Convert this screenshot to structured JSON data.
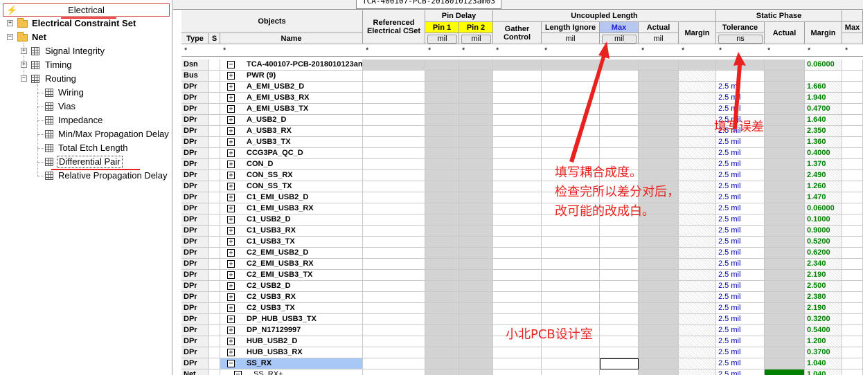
{
  "tree": {
    "root": "Electrical",
    "constraint_set": "Electrical Constraint Set",
    "net": "Net",
    "net_children": [
      "Signal Integrity",
      "Timing",
      "Routing"
    ],
    "routing_children": [
      "Wiring",
      "Vias",
      "Impedance",
      "Min/Max Propagation Delay",
      "Total Etch Length",
      "Differential Pair",
      "Relative Propagation Delay"
    ],
    "selected": "Differential Pair"
  },
  "sheet_tab": "TCA-400107-PCB-2018010123am03",
  "columns": {
    "objects": "Objects",
    "type": "Type",
    "s": "S",
    "name": "Name",
    "referenced": "Referenced Electrical CSet",
    "pin_delay": "Pin Delay",
    "pin1": "Pin 1",
    "pin2": "Pin 2",
    "uncoupled": "Uncoupled Length",
    "gather": "Gather Control",
    "length_ignore": "Length Ignore",
    "max": "Max",
    "actual": "Actual",
    "margin": "Margin",
    "static_phase": "Static Phase",
    "tolerance": "Tolerance",
    "sp_actual": "Actual",
    "sp_margin": "Margin",
    "max2": "Max",
    "unit_mil": "mil",
    "unit_ns": "ns",
    "filter": "*"
  },
  "rows": [
    {
      "type": "Dsn",
      "expander": "minus",
      "name": "TCA-400107-PCB-2018010123am",
      "tol": "",
      "margin": "0.06000"
    },
    {
      "type": "Bus",
      "expander": "plus",
      "name": "PWR (9)",
      "tol": "",
      "margin": ""
    },
    {
      "type": "DPr",
      "expander": "plus",
      "name": "A_EMI_USB2_D",
      "tol": "2.5 mil",
      "margin": "1.660"
    },
    {
      "type": "DPr",
      "expander": "plus",
      "name": "A_EMI_USB3_RX",
      "tol": "2.5 mil",
      "margin": "1.940"
    },
    {
      "type": "DPr",
      "expander": "plus",
      "name": "A_EMI_USB3_TX",
      "tol": "2.5 mil",
      "margin": "0.4700"
    },
    {
      "type": "DPr",
      "expander": "plus",
      "name": "A_USB2_D",
      "tol": "2.5 mil",
      "margin": "1.640"
    },
    {
      "type": "DPr",
      "expander": "plus",
      "name": "A_USB3_RX",
      "tol": "2.5 mil",
      "margin": "2.350"
    },
    {
      "type": "DPr",
      "expander": "plus",
      "name": "A_USB3_TX",
      "tol": "2.5 mil",
      "margin": "1.360"
    },
    {
      "type": "DPr",
      "expander": "plus",
      "name": "CCG3PA_QC_D",
      "tol": "2.5 mil",
      "margin": "0.4000"
    },
    {
      "type": "DPr",
      "expander": "plus",
      "name": "CON_D",
      "tol": "2.5 mil",
      "margin": "1.370"
    },
    {
      "type": "DPr",
      "expander": "plus",
      "name": "CON_SS_RX",
      "tol": "2.5 mil",
      "margin": "2.490"
    },
    {
      "type": "DPr",
      "expander": "plus",
      "name": "CON_SS_TX",
      "tol": "2.5 mil",
      "margin": "1.260"
    },
    {
      "type": "DPr",
      "expander": "plus",
      "name": "C1_EMI_USB2_D",
      "tol": "2.5 mil",
      "margin": "1.470"
    },
    {
      "type": "DPr",
      "expander": "plus",
      "name": "C1_EMI_USB3_RX",
      "tol": "2.5 mil",
      "margin": "0.06000"
    },
    {
      "type": "DPr",
      "expander": "plus",
      "name": "C1_USB2_D",
      "tol": "2.5 mil",
      "margin": "0.1000"
    },
    {
      "type": "DPr",
      "expander": "plus",
      "name": "C1_USB3_RX",
      "tol": "2.5 mil",
      "margin": "0.9000"
    },
    {
      "type": "DPr",
      "expander": "plus",
      "name": "C1_USB3_TX",
      "tol": "2.5 mil",
      "margin": "0.5200"
    },
    {
      "type": "DPr",
      "expander": "plus",
      "name": "C2_EMI_USB2_D",
      "tol": "2.5 mil",
      "margin": "0.6200"
    },
    {
      "type": "DPr",
      "expander": "plus",
      "name": "C2_EMI_USB3_RX",
      "tol": "2.5 mil",
      "margin": "2.340"
    },
    {
      "type": "DPr",
      "expander": "plus",
      "name": "C2_EMI_USB3_TX",
      "tol": "2.5 mil",
      "margin": "2.190"
    },
    {
      "type": "DPr",
      "expander": "plus",
      "name": "C2_USB2_D",
      "tol": "2.5 mil",
      "margin": "2.500"
    },
    {
      "type": "DPr",
      "expander": "plus",
      "name": "C2_USB3_RX",
      "tol": "2.5 mil",
      "margin": "2.380"
    },
    {
      "type": "DPr",
      "expander": "plus",
      "name": "C2_USB3_TX",
      "tol": "2.5 mil",
      "margin": "2.190"
    },
    {
      "type": "DPr",
      "expander": "plus",
      "name": "DP_HUB_USB3_TX",
      "tol": "2.5 mil",
      "margin": "0.3200"
    },
    {
      "type": "DPr",
      "expander": "plus",
      "name": "DP_N17129997",
      "tol": "2.5 mil",
      "margin": "0.5400"
    },
    {
      "type": "DPr",
      "expander": "plus",
      "name": "HUB_USB2_D",
      "tol": "2.5 mil",
      "margin": "1.200"
    },
    {
      "type": "DPr",
      "expander": "plus",
      "name": "HUB_USB3_RX",
      "tol": "2.5 mil",
      "margin": "0.3700"
    },
    {
      "type": "DPr",
      "expander": "minus",
      "name": "SS_RX",
      "tol": "2.5 mil",
      "margin": "1.040",
      "selected": true
    },
    {
      "type": "Net",
      "expander": "minus",
      "name": "SS_RX+",
      "tol": "2.5 mil",
      "margin": "1.040",
      "child": true
    }
  ],
  "annotations": {
    "tolerance_note": "填写误差",
    "coupling_note_1": "填写耦合成度。",
    "coupling_note_2": "检查完所以差分对后，",
    "coupling_note_3": "改可能的改成白。",
    "watermark": "小北PCB设计室"
  },
  "colors": {
    "annotation": "#e8231f",
    "margin_green": "#008000",
    "pin_header_yellow": "#ffff00",
    "max_header_blue": "#b7c7f0",
    "selected_row": "#a8c8f8",
    "actual_green": "#008000"
  }
}
